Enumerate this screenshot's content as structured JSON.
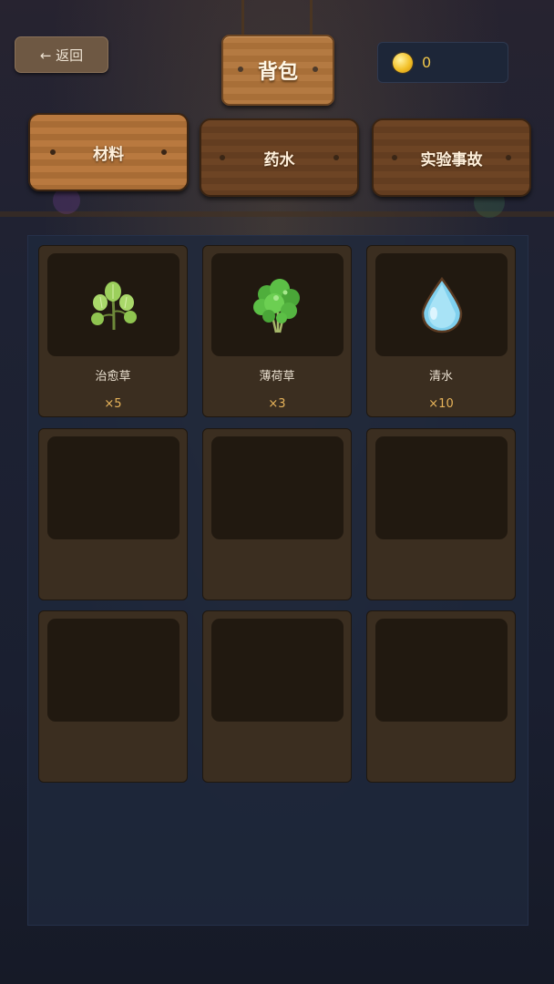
{
  "header": {
    "back_label": "← 返回",
    "title": "背包",
    "coins": "0"
  },
  "tabs": [
    {
      "label": "材料",
      "active": true
    },
    {
      "label": "药水",
      "active": false
    },
    {
      "label": "实验事故",
      "active": false
    }
  ],
  "inventory": {
    "items": [
      {
        "name": "治愈草",
        "count": "×5",
        "icon": "healing-herb-icon"
      },
      {
        "name": "薄荷草",
        "count": "×3",
        "icon": "mint-herb-icon"
      },
      {
        "name": "清水",
        "count": "×10",
        "icon": "water-drop-icon"
      }
    ],
    "empty_slots": 6
  },
  "colors": {
    "coin": "#f0c64a",
    "count_text": "#e8b45a",
    "tab_active": "#b9793f",
    "tab_inactive": "#6d4424"
  }
}
